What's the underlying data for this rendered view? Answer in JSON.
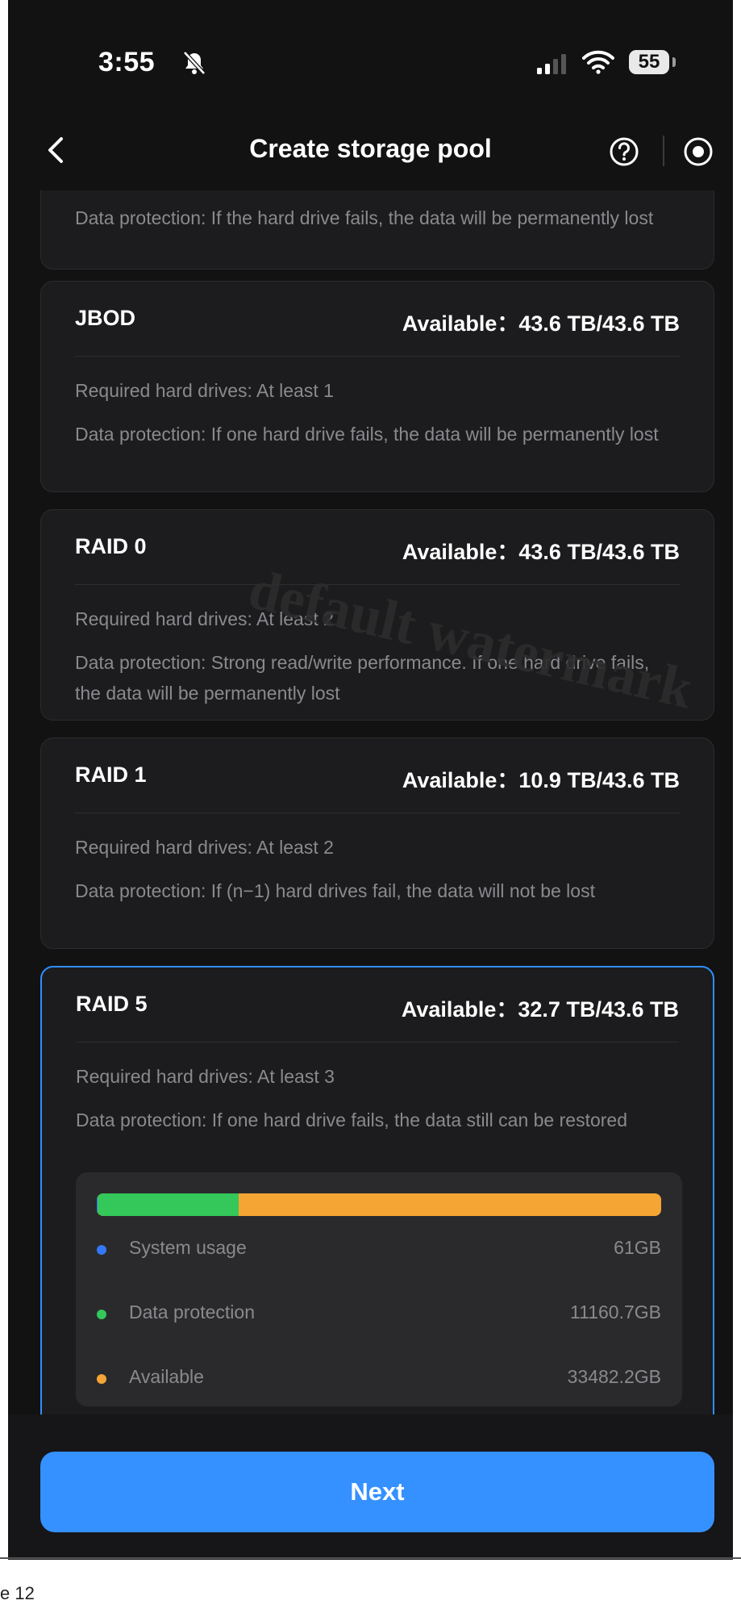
{
  "status_bar": {
    "time": "3:55",
    "battery": "55"
  },
  "header": {
    "title": "Create storage pool"
  },
  "top_card": {
    "protection": "Data protection: If the hard drive fails, the data will be permanently lost"
  },
  "cards": [
    {
      "title": "JBOD",
      "available": "Available：43.6 TB/43.6 TB",
      "required": "Required hard drives: At least 1",
      "protection": "Data protection: If one hard drive fails, the data will be permanently lost"
    },
    {
      "title": "RAID 0",
      "available": "Available：43.6 TB/43.6 TB",
      "required": "Required hard drives: At least 2",
      "protection": "Data protection: Strong read/write performance. If one hard drive fails, the data will be permanently lost"
    },
    {
      "title": "RAID 1",
      "available": "Available：10.9 TB/43.6 TB",
      "required": "Required hard drives: At least 2",
      "protection": "Data protection: If (n−1) hard drives fail, the data will not be lost"
    },
    {
      "title": "RAID 5",
      "available": "Available：32.7 TB/43.6 TB",
      "required": "Required hard drives: At least 3",
      "protection": "Data protection: If one hard drive fails, the data still can be restored"
    }
  ],
  "usage": {
    "items": [
      {
        "label": "System usage",
        "value": "61GB",
        "color": "#3478f6",
        "fraction": 0.0014
      },
      {
        "label": "Data protection",
        "value": "11160.7GB",
        "color": "#34c759",
        "fraction": 0.2496
      },
      {
        "label": "Available",
        "value": "33482.2GB",
        "color": "#f5a534",
        "fraction": 0.749
      }
    ]
  },
  "watermark": "default watermark",
  "footer": {
    "next_label": "Next"
  },
  "page_caption": "e 12"
}
